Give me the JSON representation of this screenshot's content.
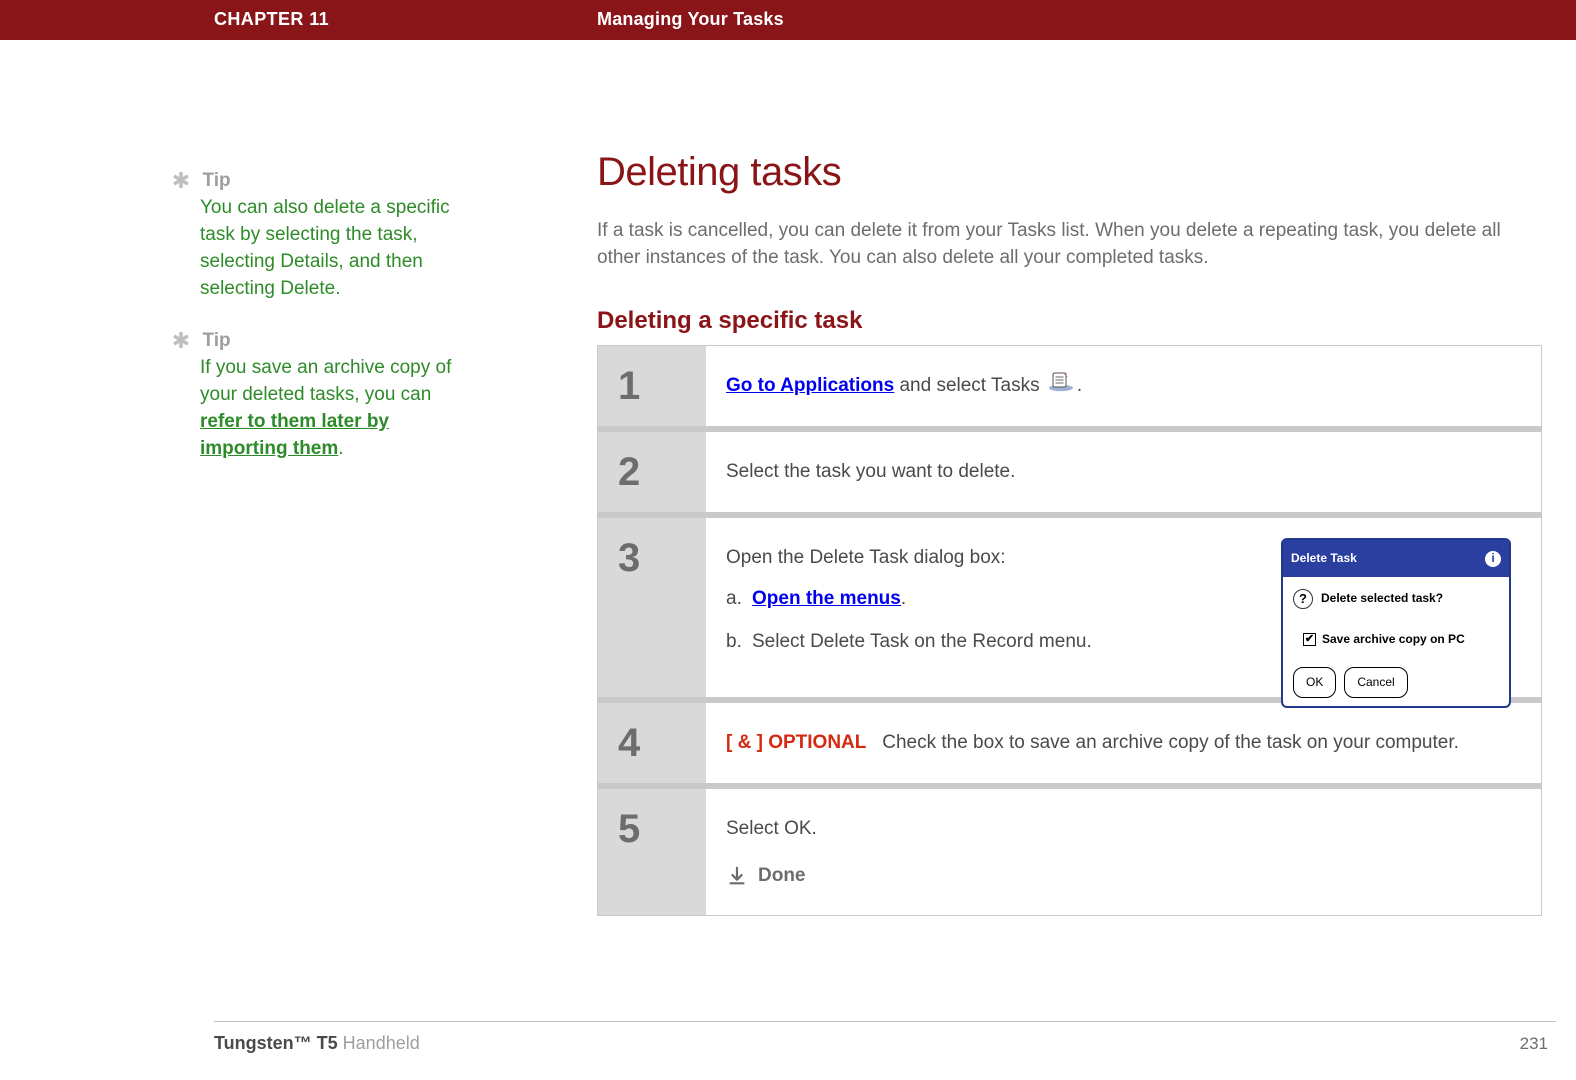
{
  "header": {
    "chapter": "CHAPTER 11",
    "title": "Managing Your Tasks"
  },
  "sidebar": {
    "tips": [
      {
        "label": "Tip",
        "body_plain": "You can also delete a specific task by selecting the task, selecting Details, and then selecting Delete."
      },
      {
        "label": "Tip",
        "body_pre": "If you save an archive copy of your deleted tasks, you can ",
        "body_link": "refer to them later by importing them",
        "body_post": "."
      }
    ]
  },
  "main": {
    "h1": "Deleting tasks",
    "lead": "If a task is cancelled, you can delete it from your Tasks list. When you delete a repeating task, you delete all other instances of the task. You can also delete all your completed tasks.",
    "h2": "Deleting a specific task",
    "steps": [
      {
        "num": "1",
        "pre_link": "Go to Applications",
        "post_link": " and select Tasks ",
        "tail": "."
      },
      {
        "num": "2",
        "text": "Select the task you want to delete."
      },
      {
        "num": "3",
        "intro": "Open the Delete Task dialog box:",
        "sub": [
          {
            "marker": "a.",
            "link": "Open the menus",
            "tail": "."
          },
          {
            "marker": "b.",
            "text": "Select Delete Task on the Record menu."
          }
        ],
        "dialog": {
          "title": "Delete Task",
          "message": "Delete selected task?",
          "checkbox": "Save archive copy on PC",
          "ok": "OK",
          "cancel": "Cancel"
        }
      },
      {
        "num": "4",
        "optional_prefix": "[ & ]  OPTIONAL",
        "text": "Check the box to save an archive copy of the task on your computer."
      },
      {
        "num": "5",
        "text": "Select OK.",
        "done": "Done"
      }
    ]
  },
  "footer": {
    "product_bold": "Tungsten™ T5",
    "product_rest": " Handheld",
    "page_number": "231"
  }
}
